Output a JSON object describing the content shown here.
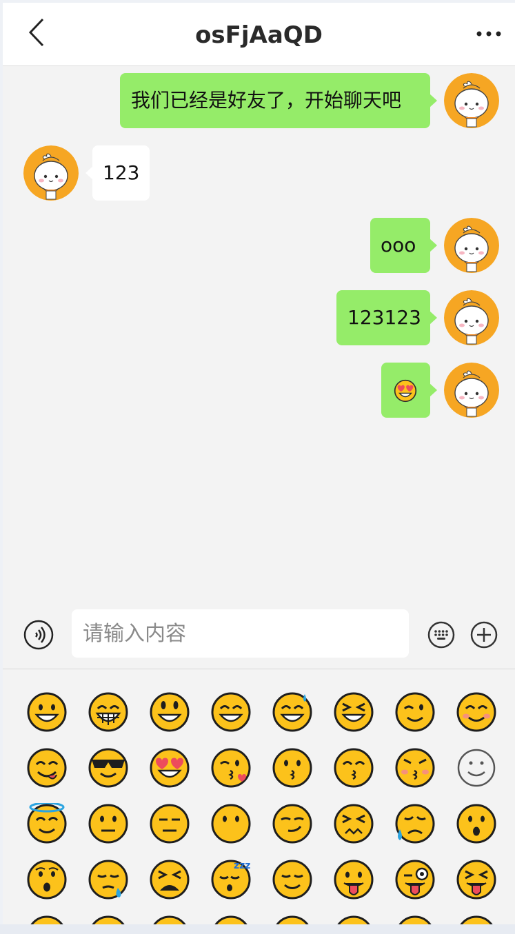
{
  "header": {
    "title": "osFjAaQD",
    "back_icon": "chevron-left-icon",
    "more_icon": "more-dots-icon"
  },
  "messages": [
    {
      "side": "me",
      "type": "text",
      "text": "我们已经是好友了，开始聊天吧"
    },
    {
      "side": "other",
      "type": "text",
      "text": "123"
    },
    {
      "side": "me",
      "type": "text",
      "text": "ooo"
    },
    {
      "side": "me",
      "type": "text",
      "text": "123123"
    },
    {
      "side": "me",
      "type": "emoji",
      "text": "heart-eyes-emoji"
    }
  ],
  "input_bar": {
    "placeholder": "请输入内容",
    "value": "",
    "voice_icon": "voice-icon",
    "emoji_icon": "emoji-keyboard-icon",
    "plus_icon": "plus-circle-icon"
  },
  "emoji_panel": {
    "emojis": [
      "grinning-face",
      "beaming-face",
      "grinning-big-eyes",
      "grinning-smiling-eyes",
      "grinning-sweat",
      "squinting-laughing",
      "winking-face",
      "smiling-blush",
      "yum-face",
      "sunglasses-face",
      "heart-eyes-face",
      "kissing-heart-face",
      "kissing-face",
      "kissing-smiling-eyes",
      "kissing-closed-eyes",
      "smiling-outline",
      "halo-face",
      "neutral-face",
      "expressionless-face",
      "no-mouth-face",
      "smirking-face",
      "persevering-face",
      "disappointed-relieved",
      "hushed-face",
      "surprised-face",
      "sleepy-face",
      "tired-face",
      "sleeping-face",
      "relieved-face",
      "tongue-face",
      "winking-tongue",
      "squinting-tongue",
      "partial-1",
      "partial-2",
      "partial-3",
      "partial-4",
      "partial-5",
      "partial-6",
      "partial-7",
      "partial-8"
    ]
  },
  "colors": {
    "my_bubble": "#95ec69",
    "other_bubble": "#ffffff",
    "avatar_bg": "#f6a623",
    "emoji_yellow": "#fcc21b"
  }
}
